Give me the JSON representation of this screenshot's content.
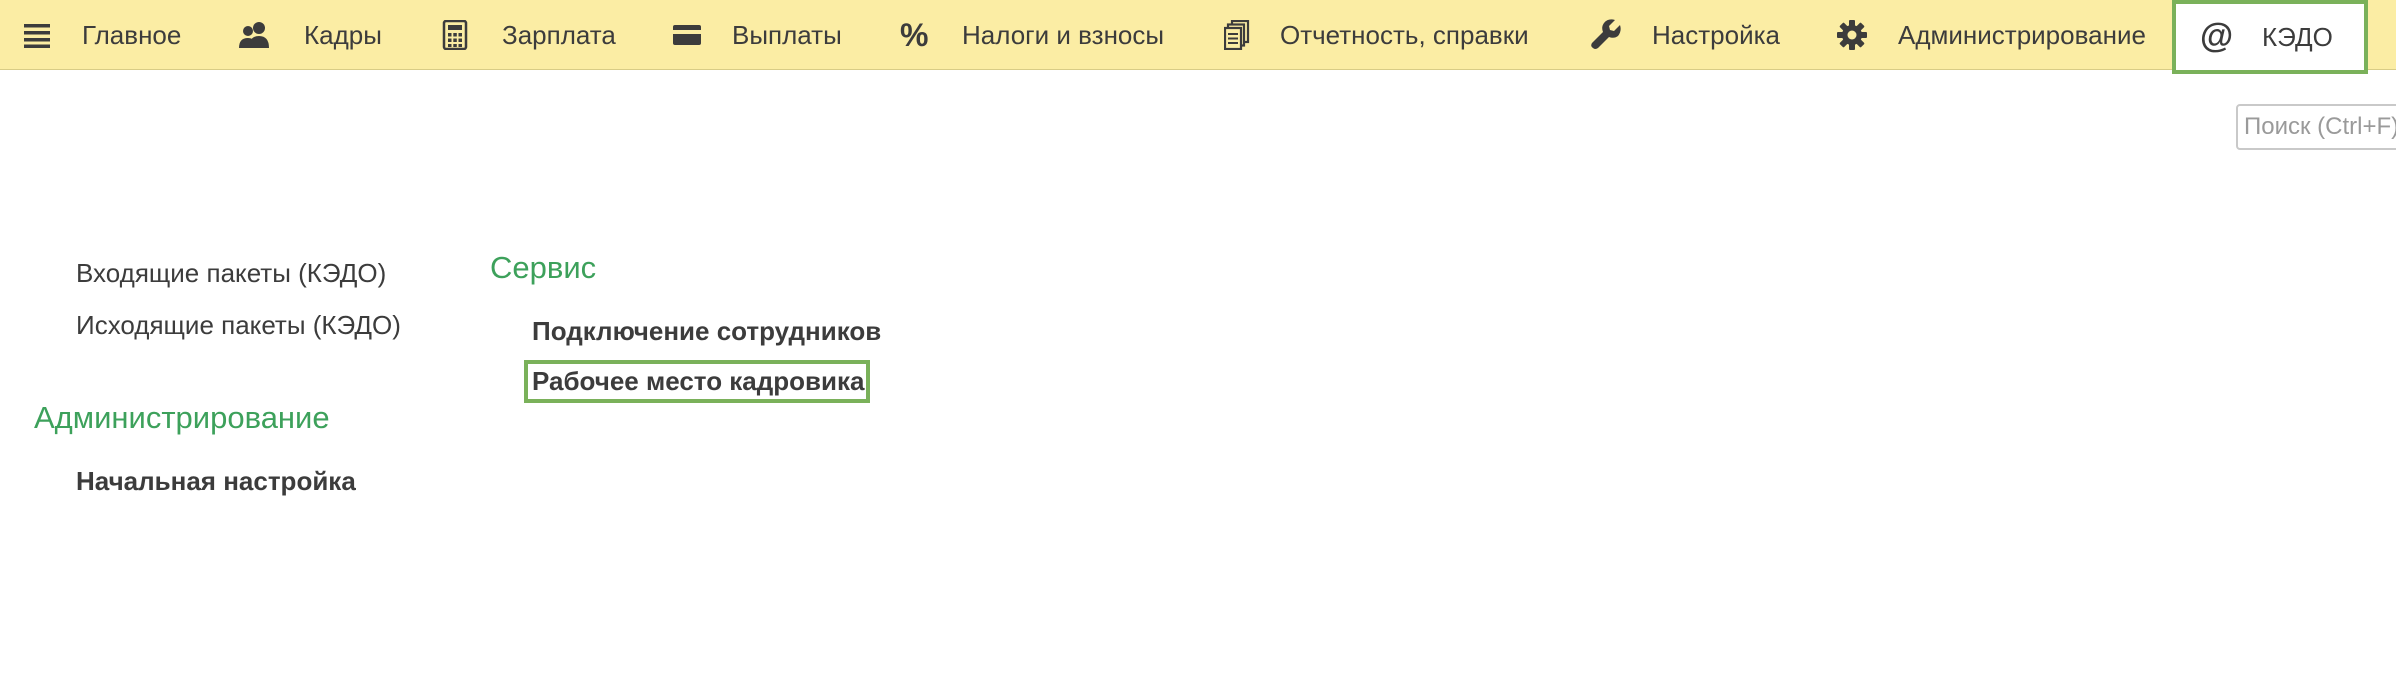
{
  "nav": {
    "items": [
      {
        "icon": "hamburger-menu-icon",
        "label": "Главное"
      },
      {
        "icon": "users-icon",
        "label": "Кадры"
      },
      {
        "icon": "calculator-icon",
        "label": "Зарплата"
      },
      {
        "icon": "wallet-icon",
        "label": "Выплаты"
      },
      {
        "icon": "percent-icon",
        "label": "Налоги и взносы"
      },
      {
        "icon": "documents-icon",
        "label": "Отчетность, справки"
      },
      {
        "icon": "wrench-icon",
        "label": "Настройка"
      },
      {
        "icon": "gear-icon",
        "label": "Администрирование"
      },
      {
        "icon": "at-sign-icon",
        "label": "КЭДО"
      }
    ],
    "selected_index": 8
  },
  "search": {
    "placeholder": "Поиск (Ctrl+F)"
  },
  "content": {
    "left_links": [
      "Входящие пакеты (КЭДО)",
      "Исходящие пакеты (КЭДО)"
    ],
    "admin_section": {
      "title": "Администрирование",
      "links": [
        "Начальная настройка"
      ]
    },
    "service_section": {
      "title": "Сервис",
      "links": [
        "Подключение сотрудников",
        "Рабочее место кадровика"
      ]
    }
  },
  "colors": {
    "topbar_bg": "#fbeda4",
    "accent_green": "#3da15b",
    "selection_border": "#7ab15a",
    "text": "#3c3c3c"
  }
}
